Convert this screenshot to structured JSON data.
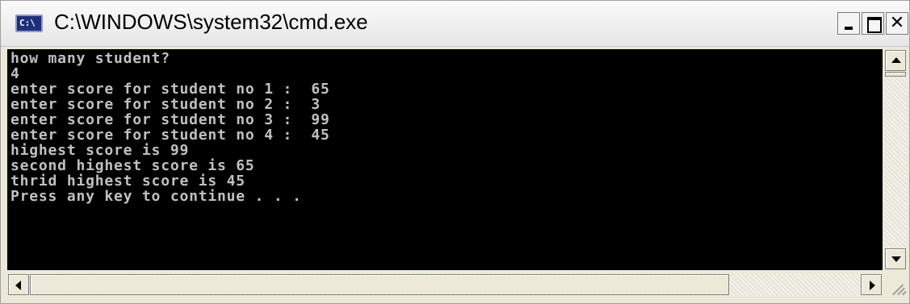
{
  "window": {
    "title": "C:\\WINDOWS\\system32\\cmd.exe",
    "icon_text": "C:\\",
    "buttons": {
      "minimize": "minimize-icon",
      "maximize": "maximize-icon",
      "close": "✕"
    }
  },
  "console": {
    "background": "#000000",
    "foreground": "#c0c0c0",
    "lines": [
      "how many student?",
      "4",
      "enter score for student no 1 :  65",
      "enter score for student no 2 :  3",
      "enter score for student no 3 :  99",
      "enter score for student no 4 :  45",
      "highest score is 99",
      "second highest score is 65",
      "thrid highest score is 45",
      "Press any key to continue . . ."
    ]
  }
}
